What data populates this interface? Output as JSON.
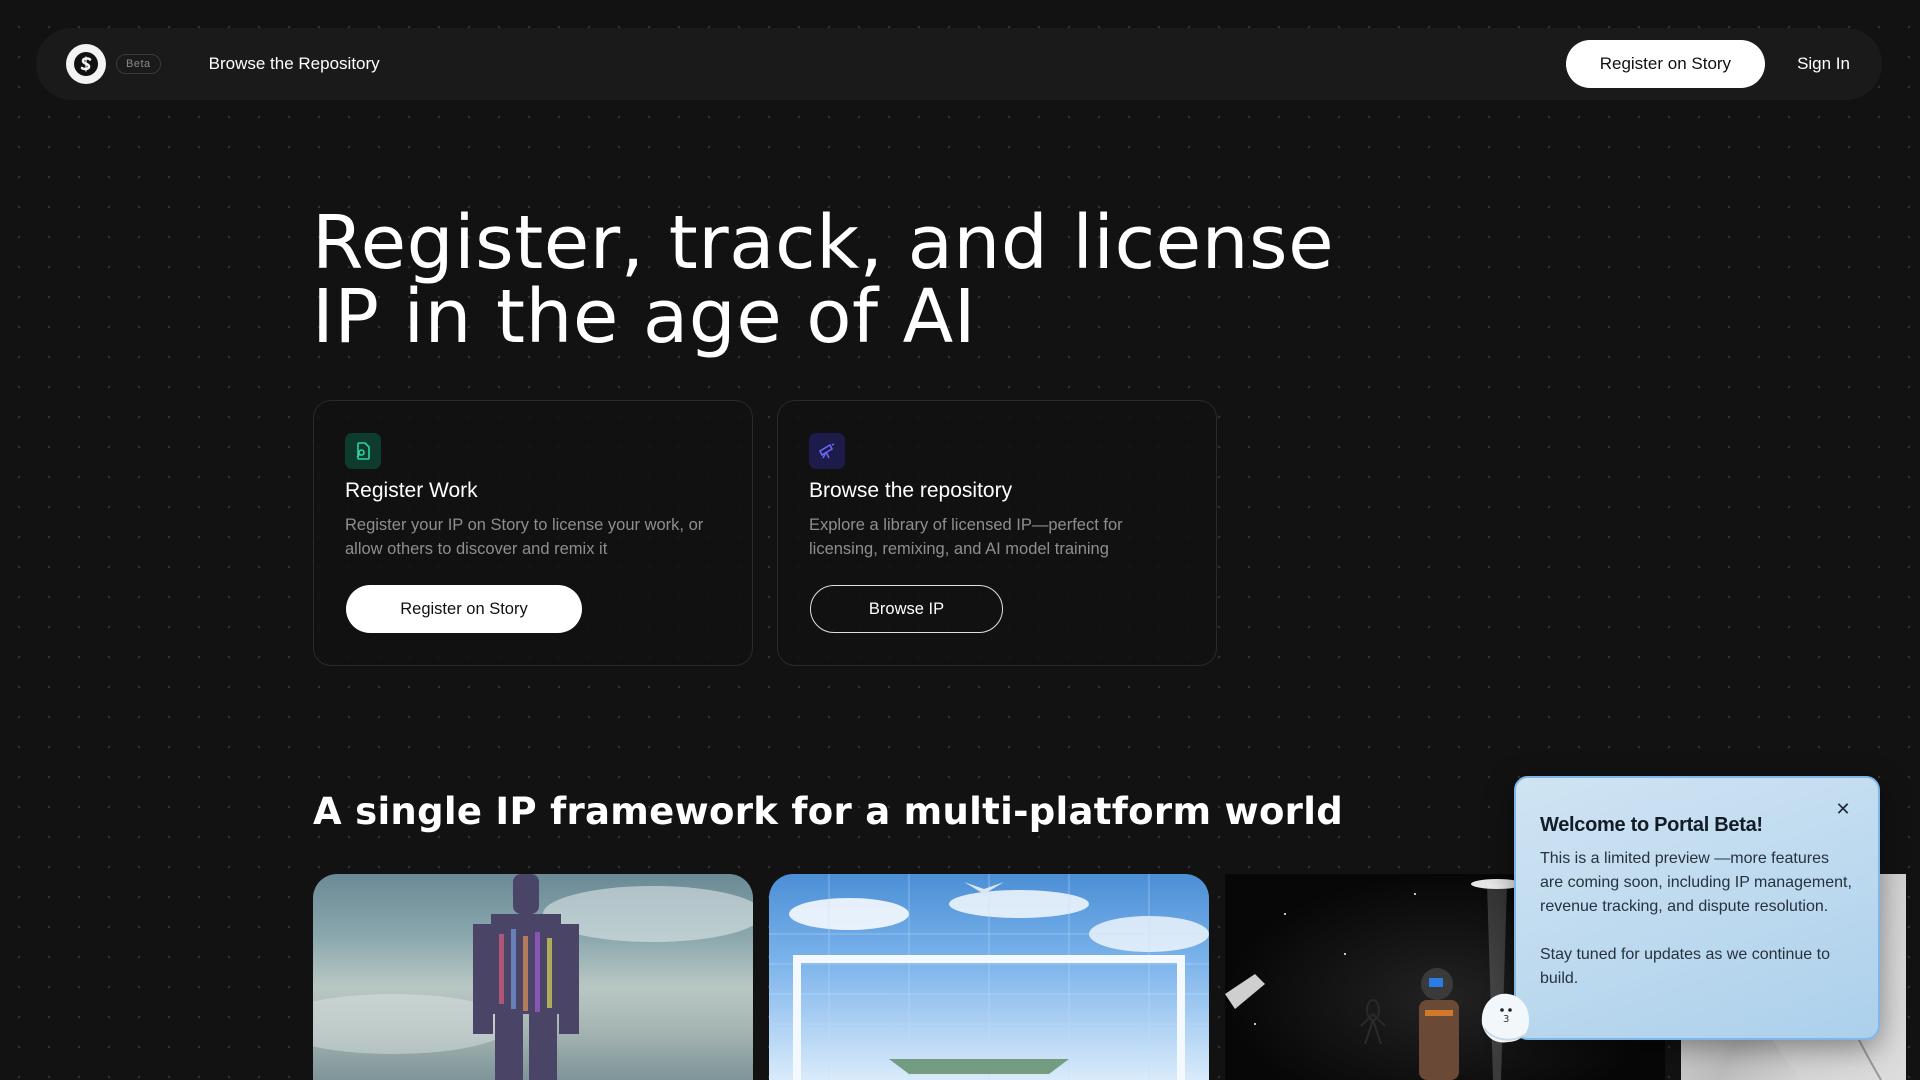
{
  "nav": {
    "beta_label": "Beta",
    "browse_link": "Browse the Repository",
    "register_button": "Register on Story",
    "signin_link": "Sign In"
  },
  "hero": {
    "title_line1": "Register, track, and license",
    "title_line2": "IP in the age of AI"
  },
  "cards": [
    {
      "icon": "file-register-icon",
      "title": "Register Work",
      "description": "Register your IP on Story to license your work, or allow others to discover and remix it",
      "button": "Register on Story"
    },
    {
      "icon": "telescope-icon",
      "title": "Browse the repository",
      "description": "Explore a library of licensed IP—perfect for licensing, remixing, and AI model training",
      "button": "Browse IP"
    }
  ],
  "section": {
    "title": "A single IP framework for a multi-platform world"
  },
  "toast": {
    "title": "Welcome to Portal Beta!",
    "body1": "This is a limited preview —more features are coming soon, including IP management, revenue tracking, and dispute resolution.",
    "body2": "Stay tuned for updates as we continue to build.",
    "close_icon": "close-icon"
  },
  "colors": {
    "background": "#121212",
    "nav_background": "#1a1a1a",
    "register_icon_bg": "#0d3b2e",
    "register_icon_fg": "#2fd39a",
    "browse_icon_bg": "#1d1b4a",
    "browse_icon_fg": "#6b6bff",
    "toast_border": "#7fb7ea"
  }
}
